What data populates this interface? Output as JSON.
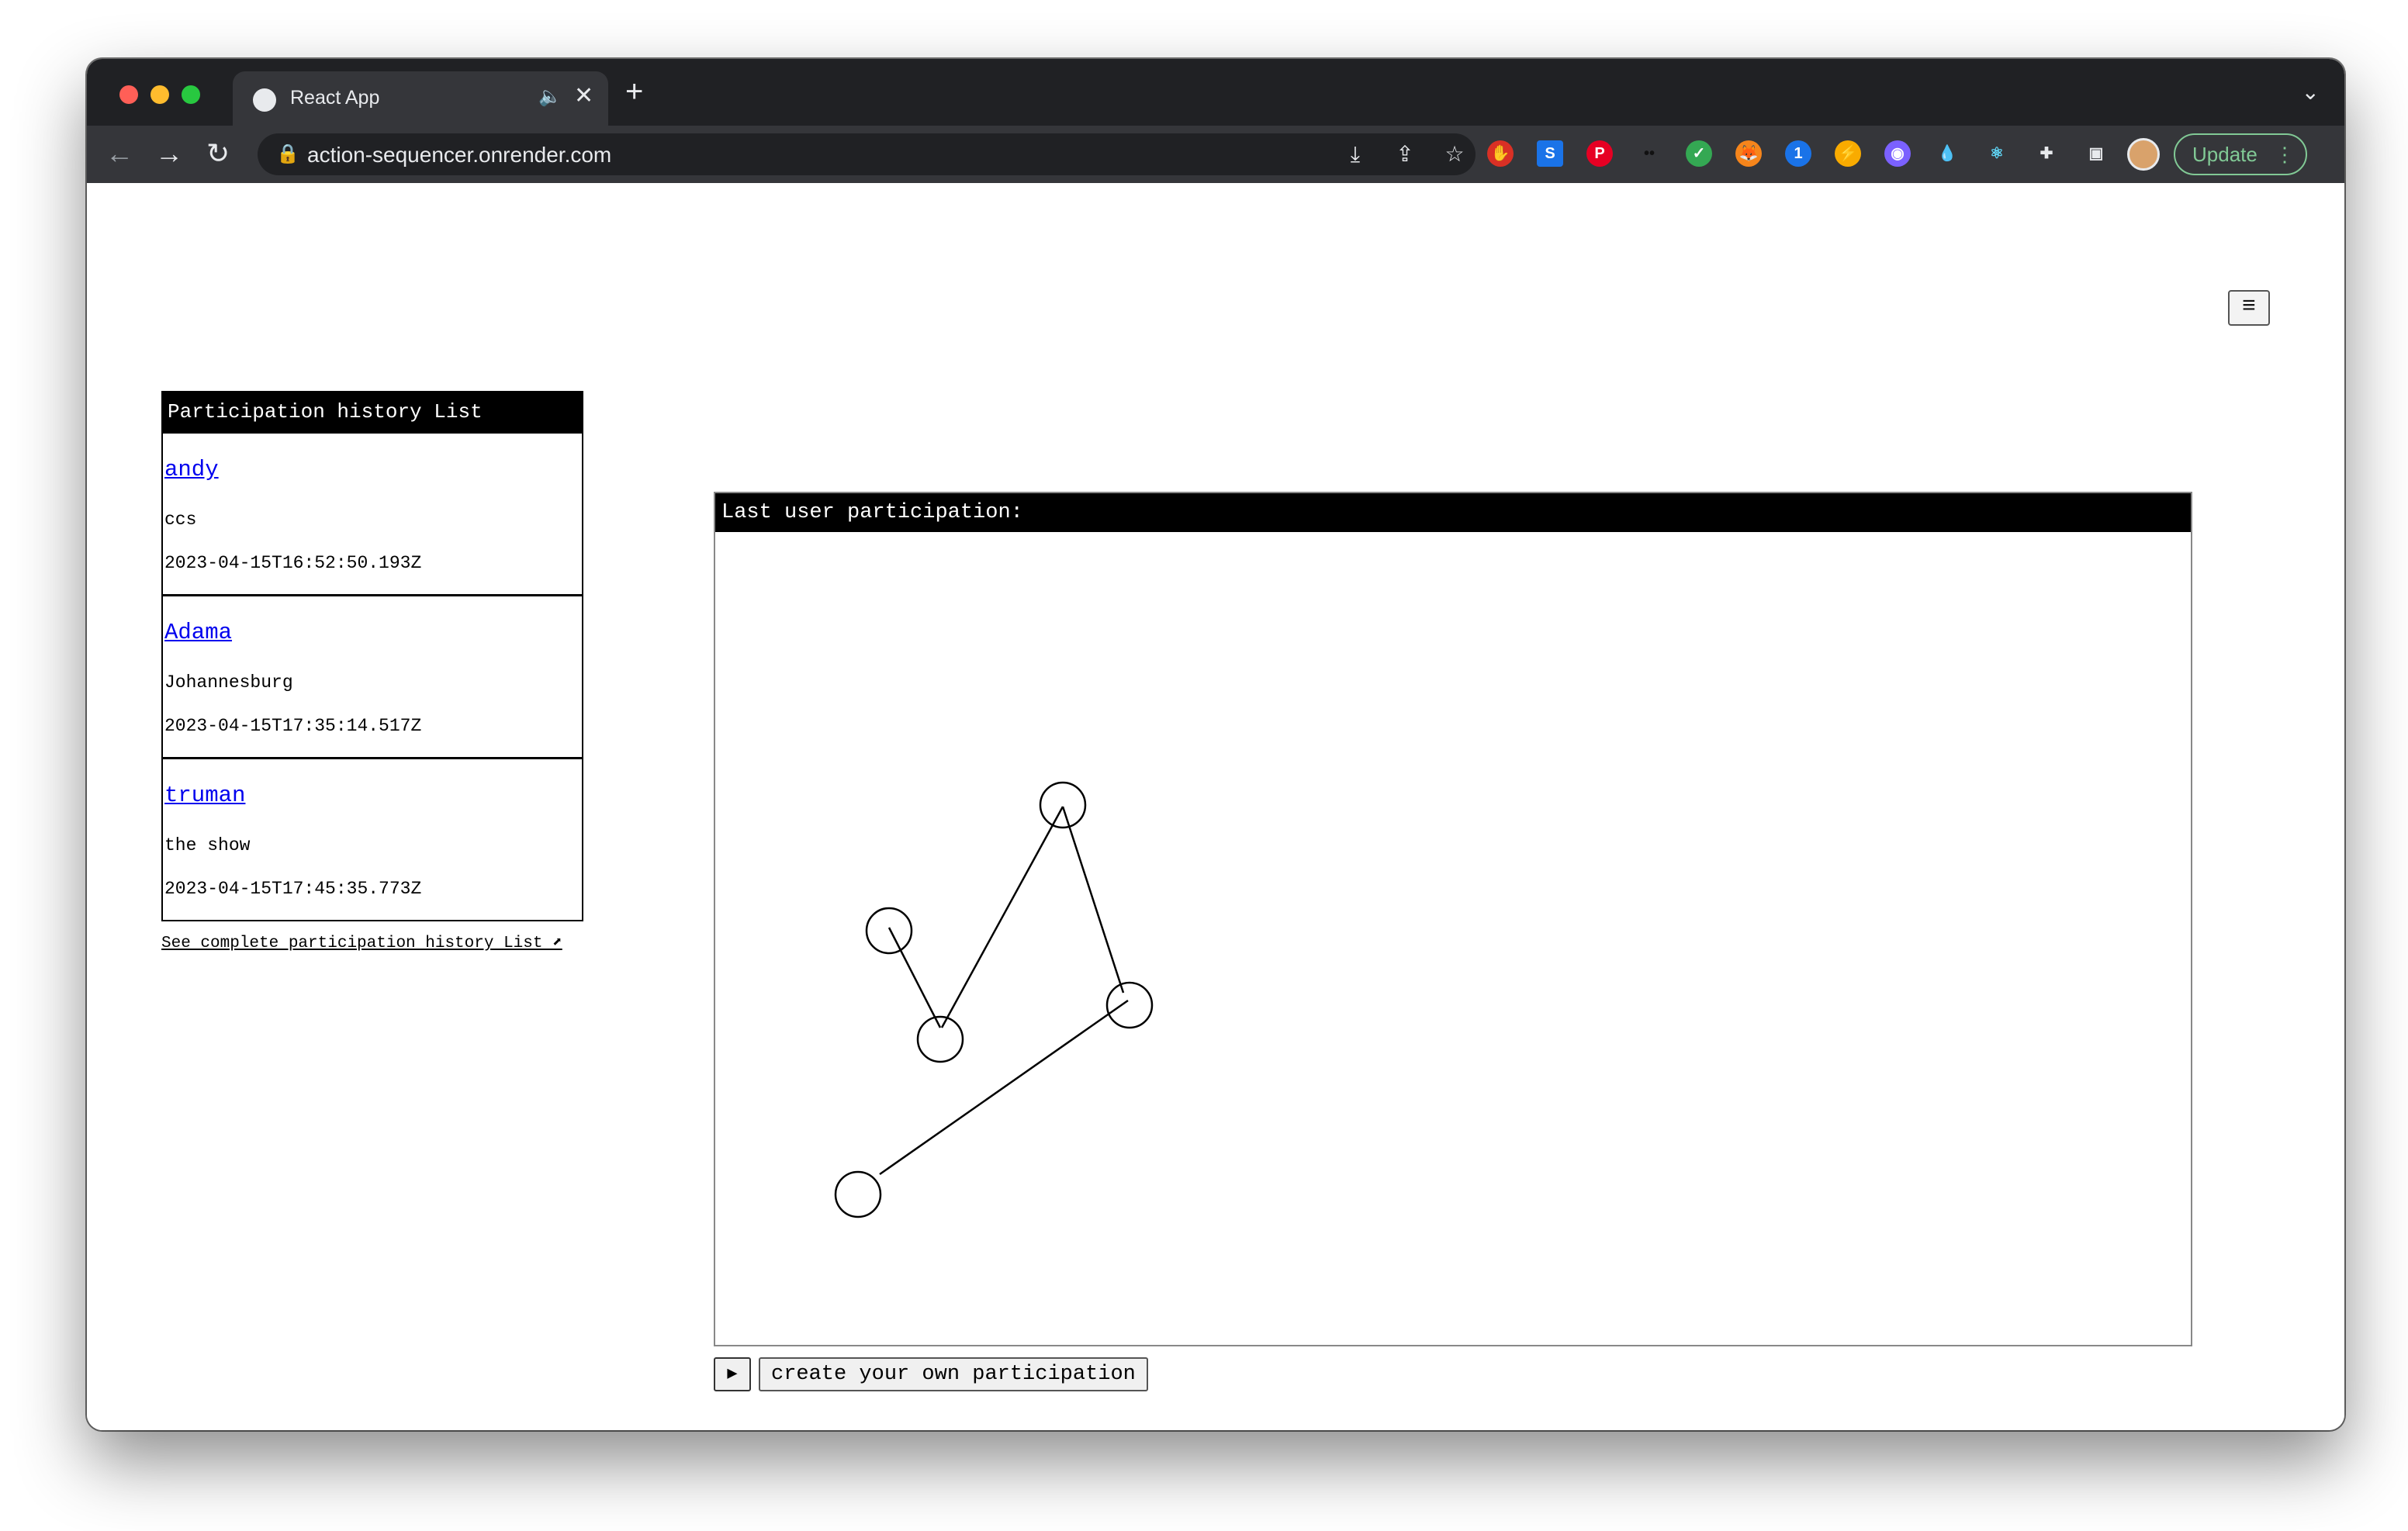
{
  "browser": {
    "tab_title": "React App",
    "new_tab_label": "+",
    "url": "action-sequencer.onrender.com",
    "update_label": "Update"
  },
  "history": {
    "header": "Participation history List",
    "items": [
      {
        "name": "andy",
        "city": "ccs",
        "date": "2023-04-15T16:52:50.193Z"
      },
      {
        "name": "Adama",
        "city": "Johannesburg",
        "date": "2023-04-15T17:35:14.517Z"
      },
      {
        "name": "truman",
        "city": "the show",
        "date": "2023-04-15T17:45:35.773Z"
      }
    ],
    "see_all_link": "See complete participation history List ⬈"
  },
  "panel": {
    "header": "Last user participation:"
  },
  "controls": {
    "play_label": "▶",
    "create_label": "create your own participation"
  }
}
